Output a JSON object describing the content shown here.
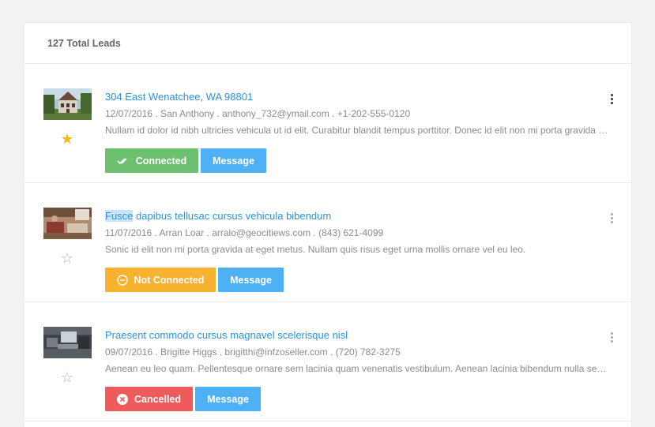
{
  "header": {
    "total_leads": "127 Total Leads"
  },
  "leads": [
    {
      "title": "304 East Wenatchee, WA 98801",
      "title_highlight": "",
      "meta": "12/07/2016 . San Anthony . anthony_732@ymail.com . +1-202-555-0120",
      "desc": "Nullam id dolor id nibh ultricies vehicula ut id elit. Curabitur blandit tempus porttitor. Donec id elit non mi porta gravida at eget metus.",
      "starred": true,
      "status_label": "Connected",
      "status": "connected",
      "message_label": "Message"
    },
    {
      "title": " dapibus tellusac cursus vehicula bibendum",
      "title_highlight": "Fusce",
      "meta": "11/07/2016 . Arran Loar . arralo@geocitiews.com . (843) 621-4099",
      "desc": "Sonic id elit non mi porta gravida at eget metus. Nullam quis risus eget urna mollis ornare vel eu leo.",
      "starred": false,
      "status_label": "Not Connected",
      "status": "not-connected",
      "message_label": "Message"
    },
    {
      "title": "Praesent commodo cursus magnavel scelerisque nisl",
      "title_highlight": "",
      "meta": "09/07/2016 . Brigitte Higgs . brigitthi@infzoseller.com . (720) 782-3275",
      "desc": "Aenean eu leo quam. Pellentesque ornare sem lacinia quam venenatis vestibulum. Aenean lacinia bibendum nulla sed consectetur.",
      "starred": false,
      "status_label": "Cancelled",
      "status": "cancelled",
      "message_label": "Message"
    }
  ],
  "colors": {
    "link": "#2b93d9",
    "connected": "#6cc070",
    "not_connected": "#f9b22f",
    "cancelled": "#ef5b5b",
    "message": "#4fb1f5",
    "star": "#f5b90f"
  },
  "icons": {
    "star_on": "star-filled-icon",
    "star_off": "star-outline-icon",
    "connected": "double-check-icon",
    "not_connected": "minus-circle-icon",
    "cancelled": "close-circle-icon",
    "more": "more-vertical-icon"
  }
}
